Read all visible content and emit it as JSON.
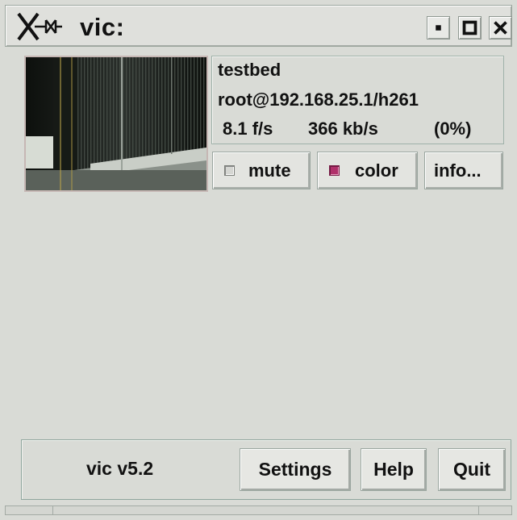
{
  "window": {
    "title": "vic:",
    "logo_icon": "x-window-logo-icon",
    "controls": [
      "minimize-icon",
      "maximize-icon",
      "close-icon"
    ]
  },
  "stream": {
    "name": "testbed",
    "source": "root@192.168.25.1/h261",
    "frame_rate": "8.1 f/s",
    "bitrate": "366 kb/s",
    "loss": "(0%)"
  },
  "controls": {
    "mute_label": "mute",
    "mute_checked": false,
    "color_label": "color",
    "color_checked": true,
    "info_label": "info..."
  },
  "footer": {
    "version": "vic v5.2",
    "settings_label": "Settings",
    "help_label": "Help",
    "quit_label": "Quit"
  },
  "colors": {
    "background": "#d9dbd6",
    "check_on": "#b0306a"
  }
}
